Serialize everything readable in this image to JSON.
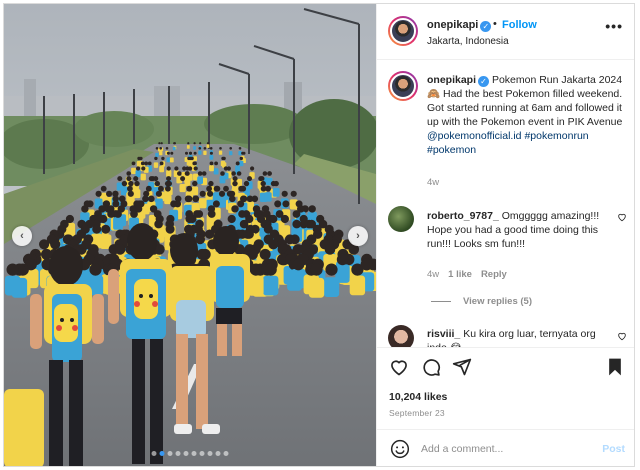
{
  "post": {
    "username": "onepikapi",
    "separator": "•",
    "follow_label": "Follow",
    "location": "Jakarta, Indonesia",
    "more_label": "•••"
  },
  "caption": {
    "username": "onepikapi",
    "text_part1": "Pokemon Run Jakarta 2024",
    "emoji": "🙈",
    "text_part2": "Had the best Pokemon filled weekend. Got started running at 6am and followed it up with the Pokemon event in PIK Avenue",
    "mention": "@pokemonofficial.id",
    "hashtag1": "#pokemonrun",
    "hashtag2": "#pokemon",
    "time": "4w"
  },
  "comments": [
    {
      "username": "roberto_9787_",
      "text": "Omggggg amazing!!! Hope you had a good time doing this run!!! Looks sm fun!!!",
      "time": "4w",
      "likes": "1 like",
      "reply_label": "Reply",
      "view_replies": "View replies (5)"
    },
    {
      "username": "risviii_",
      "text": "Ku kira org luar, ternyata org indo",
      "emoji": "😂"
    }
  ],
  "stats": {
    "likes": "10,204 likes",
    "date": "September 23"
  },
  "add_comment": {
    "placeholder": "Add a comment...",
    "post_label": "Post"
  },
  "media": {
    "prev_label": "‹",
    "next_label": "›"
  },
  "icons": {
    "verified": "verified-badge-icon",
    "like": "heart-icon",
    "comment": "comment-icon",
    "share": "paper-plane-icon",
    "save": "bookmark-icon",
    "emoji": "smiley-icon"
  },
  "colors": {
    "link": "#00376b",
    "follow": "#0095f6",
    "verified": "#3897f0",
    "muted": "#8e8e8e",
    "shirt_yellow": "#f2d34a",
    "shirt_blue": "#3aa3d6"
  }
}
